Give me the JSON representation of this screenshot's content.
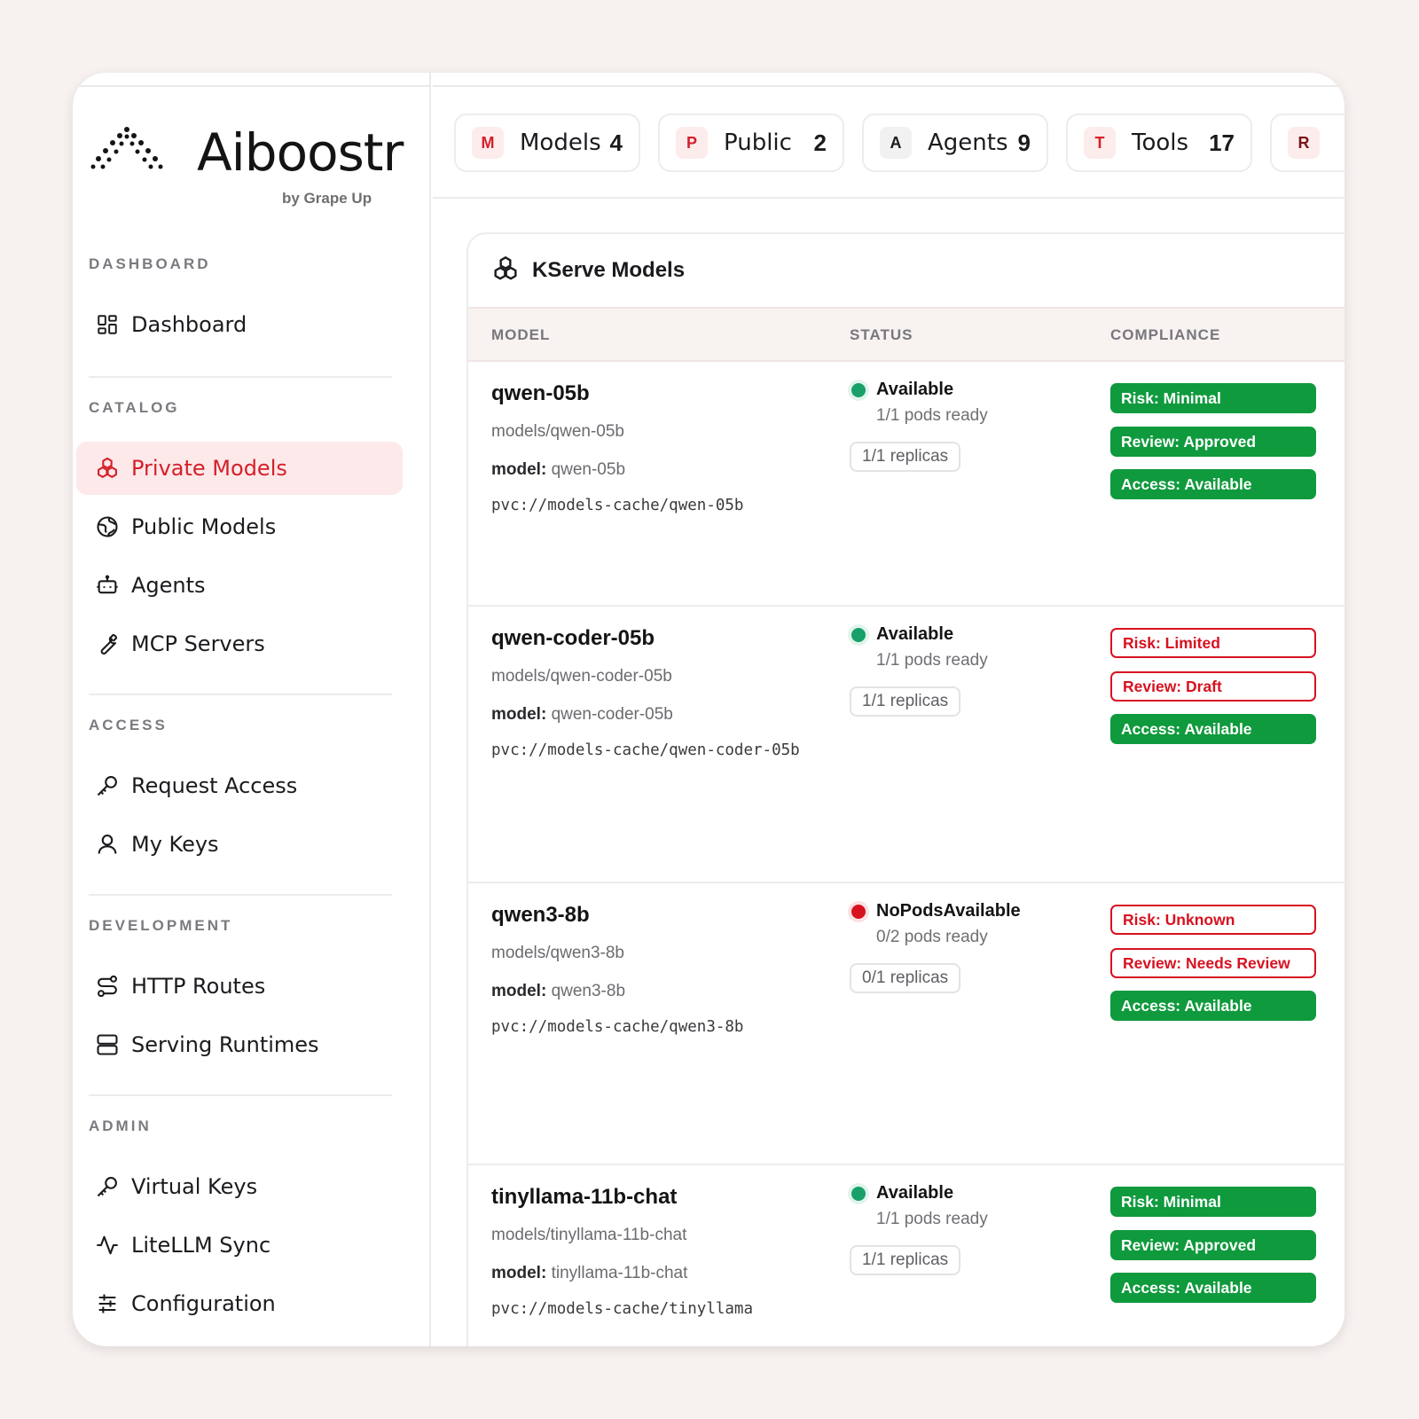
{
  "brand": {
    "name": "Aiboostr",
    "sub": "by Grape Up"
  },
  "nav": {
    "sections": {
      "dashboard": "DASHBOARD",
      "catalog": "CATALOG",
      "access": "ACCESS",
      "development": "DEVELOPMENT",
      "admin": "ADMIN"
    },
    "items": {
      "dashboard": "Dashboard",
      "private_models": "Private Models",
      "public_models": "Public Models",
      "agents": "Agents",
      "mcp_servers": "MCP Servers",
      "request_access": "Request Access",
      "my_keys": "My Keys",
      "http_routes": "HTTP Routes",
      "serving_runtimes": "Serving Runtimes",
      "virtual_keys": "Virtual Keys",
      "litellm_sync": "LiteLLM Sync",
      "configuration": "Configuration"
    },
    "active": "Private Models"
  },
  "stats": [
    {
      "letter": "M",
      "label": "Models",
      "count": "4"
    },
    {
      "letter": "P",
      "label": "Public",
      "count": "2"
    },
    {
      "letter": "A",
      "label": "Agents",
      "count": "9"
    },
    {
      "letter": "T",
      "label": "Tools",
      "count": "17"
    },
    {
      "letter": "R",
      "label": "",
      "count": ""
    }
  ],
  "card": {
    "title": "KServe Models",
    "columns": {
      "model": "MODEL",
      "status": "STATUS",
      "compliance": "COMPLIANCE"
    }
  },
  "rows": [
    {
      "name": "qwen-05b",
      "path": "models/qwen-05b",
      "model_label": "model:",
      "model": "qwen-05b",
      "pvc": "pvc://models-cache/qwen-05b",
      "status": "Available",
      "pods": "1/1 pods ready",
      "replicas": "1/1 replicas",
      "risk": "Risk: Minimal",
      "review": "Review: Approved",
      "access": "Access: Available"
    },
    {
      "name": "qwen-coder-05b",
      "path": "models/qwen-coder-05b",
      "model_label": "model:",
      "model": "qwen-coder-05b",
      "pvc": "pvc://models-cache/qwen-coder-05b",
      "status": "Available",
      "pods": "1/1 pods ready",
      "replicas": "1/1 replicas",
      "risk": "Risk: Limited",
      "review": "Review: Draft",
      "access": "Access: Available"
    },
    {
      "name": "qwen3-8b",
      "path": "models/qwen3-8b",
      "model_label": "model:",
      "model": "qwen3-8b",
      "pvc": "pvc://models-cache/qwen3-8b",
      "status": "NoPodsAvailable",
      "pods": "0/2 pods ready",
      "replicas": "0/1 replicas",
      "risk": "Risk: Unknown",
      "review": "Review: Needs Review",
      "access": "Access: Available"
    },
    {
      "name": "tinyllama-11b-chat",
      "path": "models/tinyllama-11b-chat",
      "model_label": "model:",
      "model": "tinyllama-11b-chat",
      "pvc": "pvc://models-cache/tinyllama",
      "status": "Available",
      "pods": "1/1 pods ready",
      "replicas": "1/1 replicas",
      "risk": "Risk: Minimal",
      "review": "Review: Approved",
      "access": "Access: Available"
    }
  ],
  "colors": {
    "accent": "#d42029",
    "ok_badge": "#0f9a3d",
    "status_green": "#19a06a",
    "status_red": "#d71220",
    "background": "#f7f1f0"
  },
  "icons": {
    "dashboard": "grid-icon",
    "private_models": "cubes-icon",
    "public_models": "globe-icon",
    "agents": "bot-icon",
    "mcp_servers": "wrench-icon",
    "request_access": "key-icon",
    "my_keys": "user-icon",
    "http_routes": "route-icon",
    "serving_runtimes": "server-icon",
    "virtual_keys": "key-icon",
    "litellm_sync": "activity-icon",
    "configuration": "sliders-icon"
  }
}
